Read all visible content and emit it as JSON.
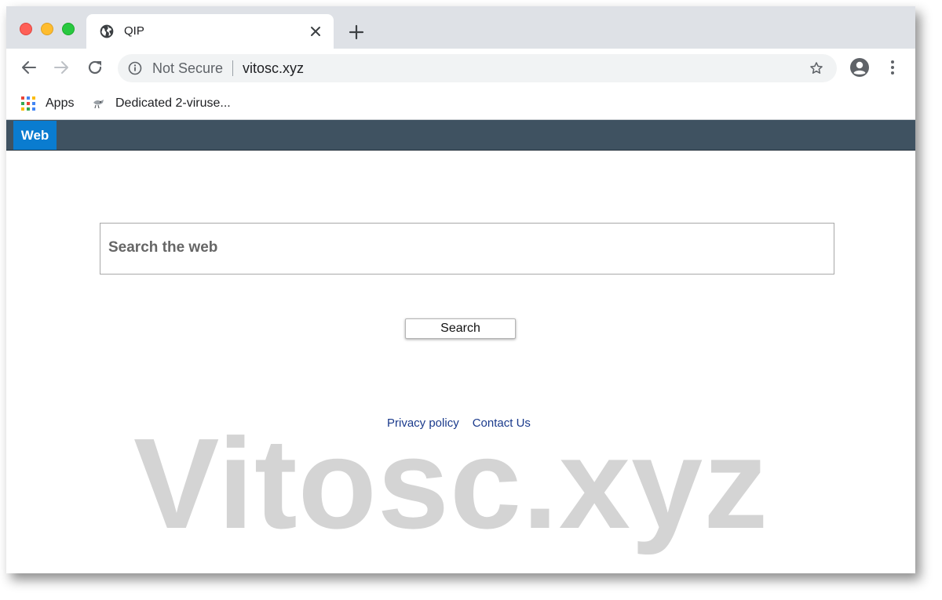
{
  "browser": {
    "tab": {
      "title": "QIP",
      "favicon": "globe-icon"
    },
    "omnibox": {
      "security_label": "Not Secure",
      "url": "vitosc.xyz"
    },
    "bookmarks": [
      {
        "label": "Apps",
        "icon": "apps-grid-icon"
      },
      {
        "label": "Dedicated 2-viruse...",
        "icon": "bookmark-favicon"
      }
    ]
  },
  "page": {
    "nav": {
      "active_tab": "Web"
    },
    "search": {
      "placeholder": "Search the web",
      "button_label": "Search"
    },
    "footer": {
      "privacy": "Privacy policy",
      "contact": "Contact Us"
    },
    "watermark": "Vitosc.xyz"
  },
  "colors": {
    "nav_bar": "#3f5261",
    "active_tab": "#0a7cd0",
    "link": "#1a3a8c",
    "watermark": "#d4d4d4",
    "tabstrip": "#dee1e6"
  }
}
